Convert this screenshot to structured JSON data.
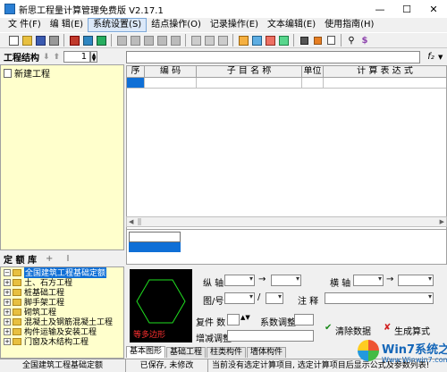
{
  "window": {
    "title": "新思工程量计算管理免费版 V2.17.1",
    "minimize": "—",
    "maximize": "☐",
    "close": "✕"
  },
  "menu": [
    {
      "label": "文 件(F)"
    },
    {
      "label": "编 辑(E)"
    },
    {
      "label": "系统设置(S)"
    },
    {
      "label": "结点操作(O)"
    },
    {
      "label": "记录操作(E)"
    },
    {
      "label": "文本编辑(E)"
    },
    {
      "label": "使用指南(H)"
    }
  ],
  "toolbar": {
    "binoculars": "⚲",
    "dollar": "$"
  },
  "structure_pane": {
    "title": "工程结构",
    "spin_value": "1",
    "root_node": "新建工程"
  },
  "grid": {
    "fx": "f₂",
    "columns": [
      "序",
      "编  码",
      "子 目 名 称",
      "单位",
      "计  算  表  达  式"
    ]
  },
  "quota_pane": {
    "title": "定 额 库",
    "ops": "+ I",
    "nodes": [
      {
        "label": "全国建筑工程基础定额",
        "expander": "−",
        "root": true
      },
      {
        "label": "土、石方工程",
        "expander": "+"
      },
      {
        "label": "桩基础工程",
        "expander": "+"
      },
      {
        "label": "脚手架工程",
        "expander": "+"
      },
      {
        "label": "砌筑工程",
        "expander": "+"
      },
      {
        "label": "混凝土及钢筋混凝土工程",
        "expander": "+"
      },
      {
        "label": "构件运输及安装工程",
        "expander": "+"
      },
      {
        "label": "门窗及木结构工程",
        "expander": "+"
      }
    ]
  },
  "params": {
    "preview_caption": "等多边形",
    "vertical_axis": "纵  轴",
    "horizontal_axis": "横 轴",
    "drawing_no": "图/号",
    "slash": "/",
    "arrow": "→",
    "note": "注  释",
    "count": "复件 数",
    "coef": "系数调整",
    "deduct": "增减调整",
    "clear_btn": "清除数据",
    "generate_btn": "生成算式"
  },
  "tabs": [
    "基本图形",
    "基础工程",
    "柱类构件",
    "墙体构件"
  ],
  "status": {
    "left": "全国建筑工程基础定额",
    "state": "已保存, 未修改",
    "hint": "当前没有选定计算项目, 选定计算项目后显示公式及参数列表!"
  },
  "watermark": {
    "text": "Win7系统之家",
    "url": "Www.Winwin7.com"
  }
}
